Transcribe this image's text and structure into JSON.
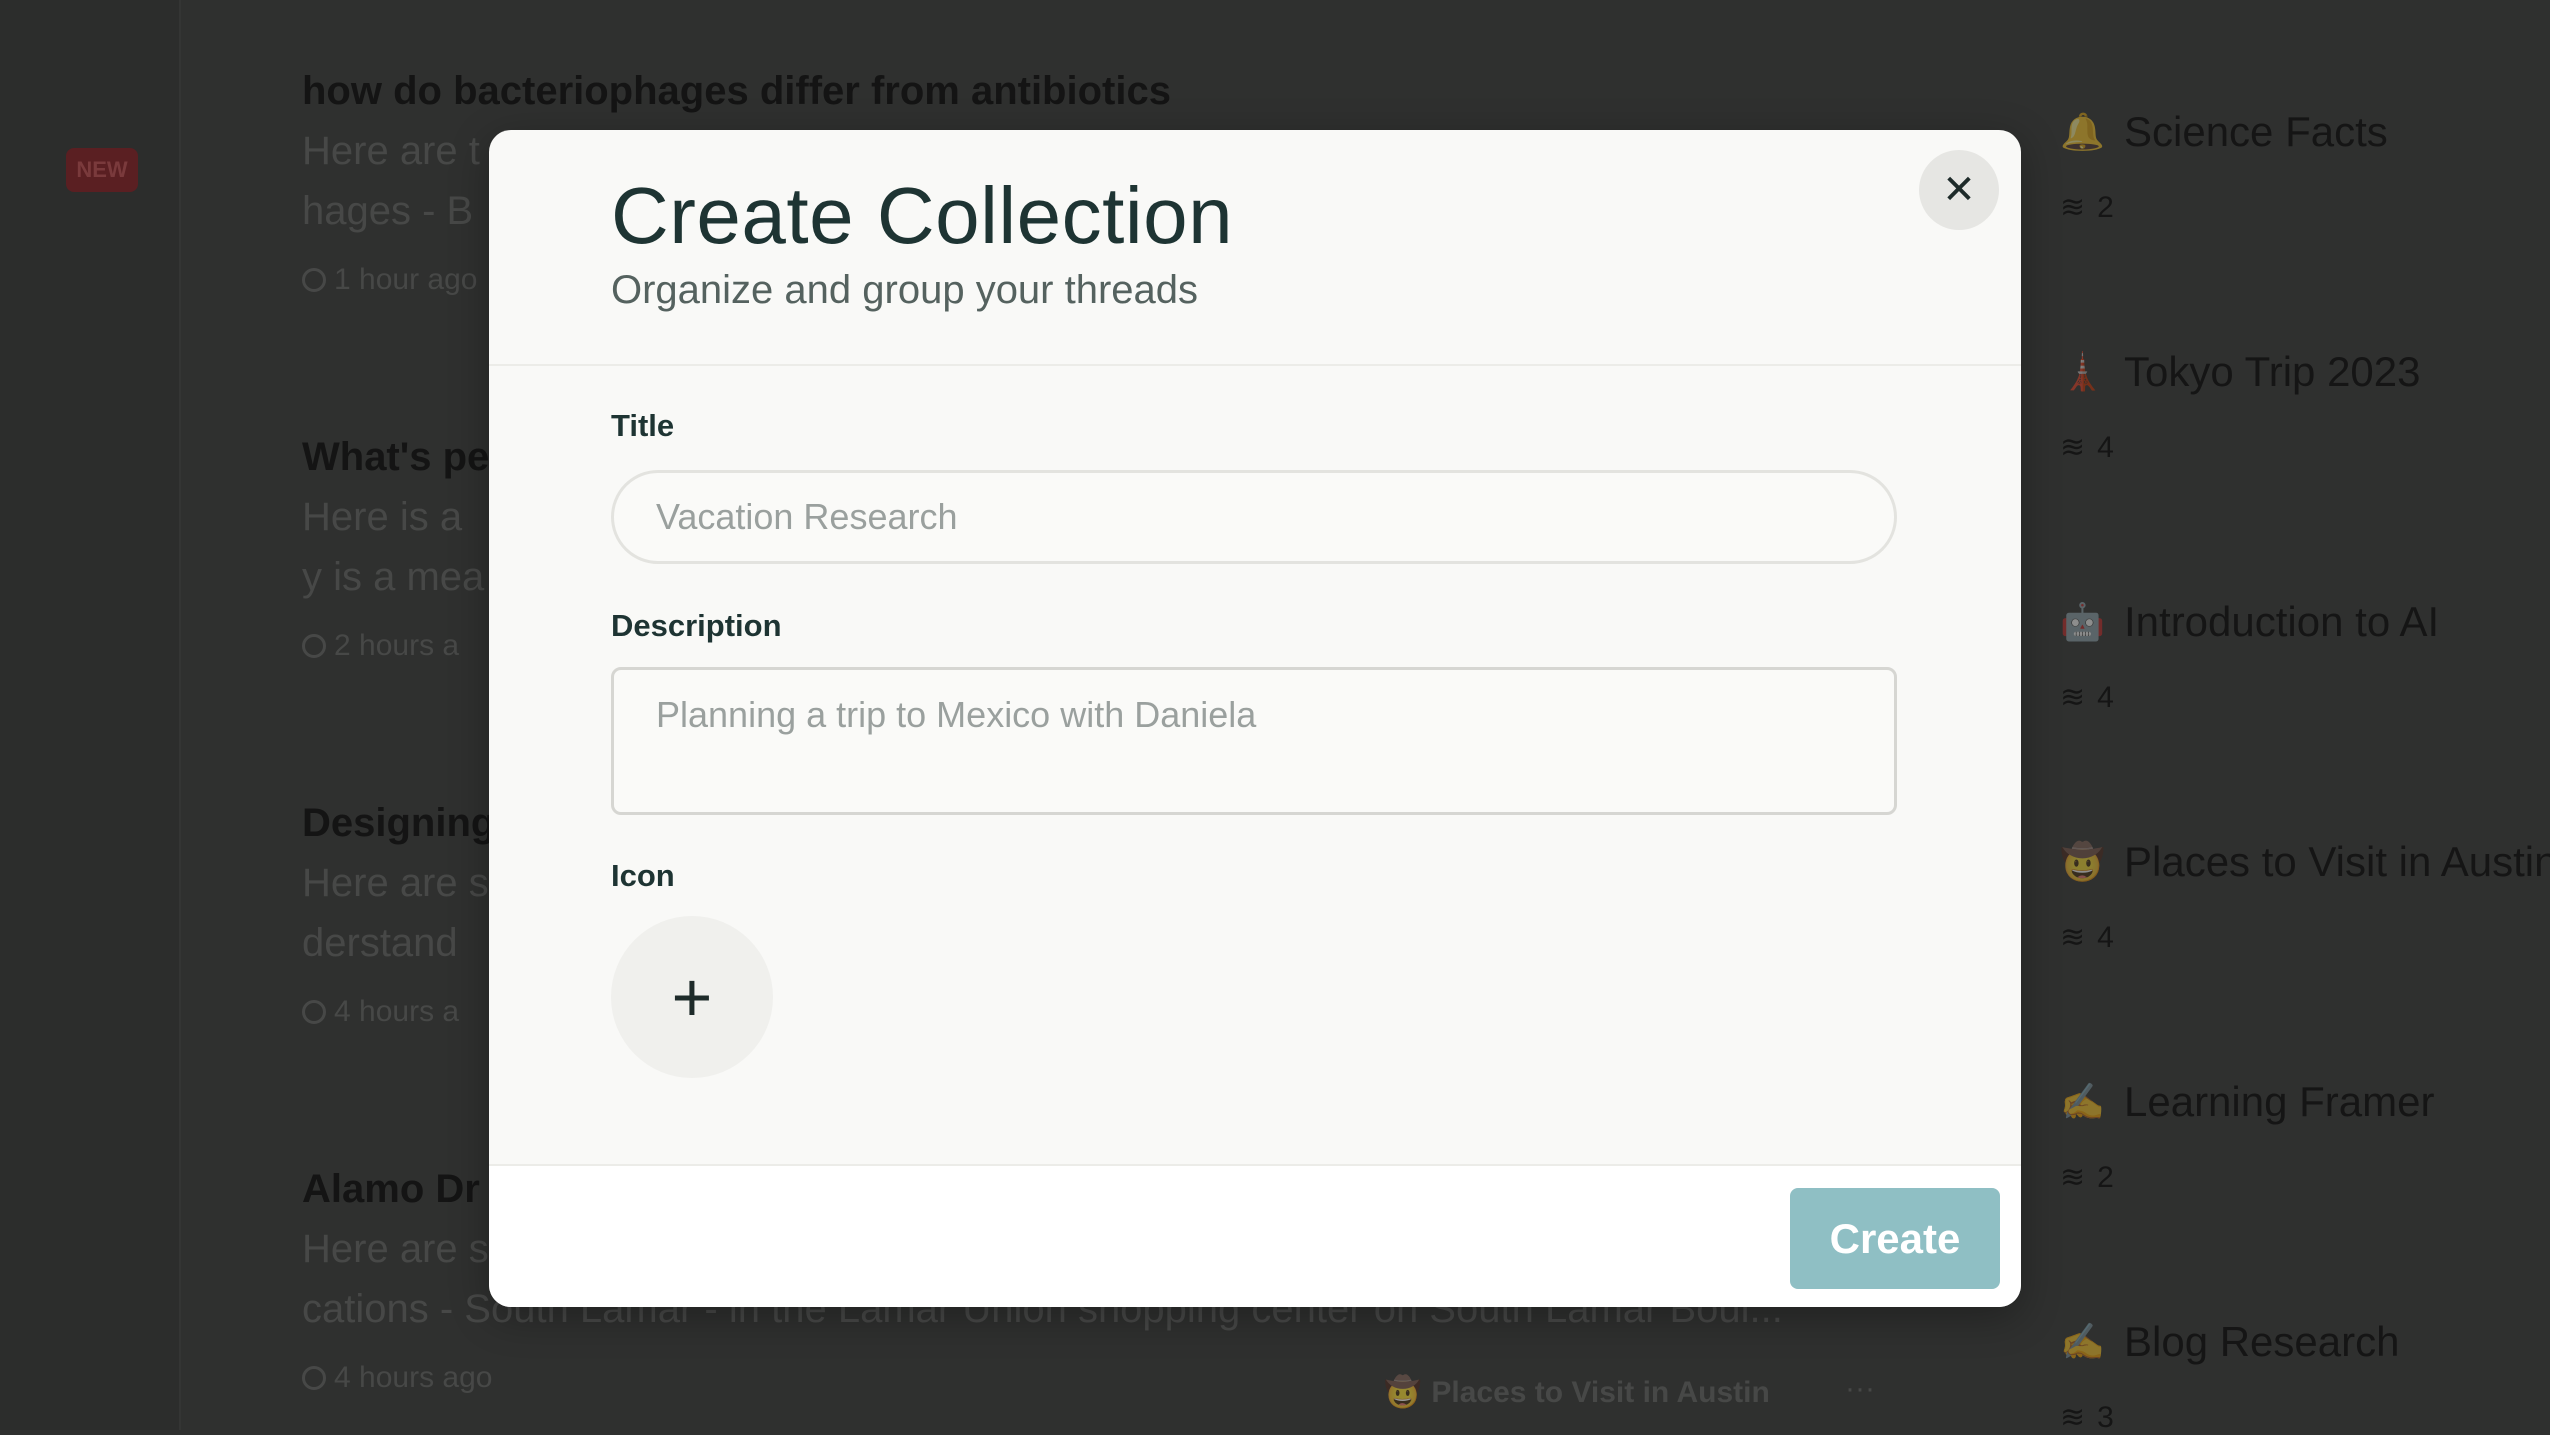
{
  "sidebar": {
    "badge": "NEW"
  },
  "threads": [
    {
      "title": "how do bacteriophages differ from antibiotics",
      "lines": [
        "Here are t",
        "hages - B"
      ],
      "time": "1 hour ago"
    },
    {
      "title": "What's pe",
      "lines": [
        "Here is a",
        "y is a mea"
      ],
      "time": "2 hours a"
    },
    {
      "title": "Designing",
      "lines": [
        "Here are s",
        "derstand"
      ],
      "time": "4 hours a"
    },
    {
      "title": "Alamo Dr",
      "lines": [
        "Here are s",
        "cations - South Lamar - in the Lamar Union shopping center on South Lamar Boul..."
      ],
      "time": "4 hours ago",
      "collection": "Places to Visit in Austin",
      "more": "···"
    }
  ],
  "collections": [
    {
      "icon": "🔔",
      "name": "Science Facts",
      "count": "2"
    },
    {
      "icon": "🗼",
      "name": "Tokyo Trip 2023",
      "count": "4"
    },
    {
      "icon": "🤖",
      "name": "Introduction to AI",
      "count": "4"
    },
    {
      "icon": "🤠",
      "name": "Places to Visit in Austin",
      "count": "4"
    },
    {
      "icon": "✍",
      "name": "Learning Framer",
      "count": "2"
    },
    {
      "icon": "✍",
      "name": "Blog Research",
      "count": "3"
    }
  ],
  "modal": {
    "title": "Create Collection",
    "subtitle": "Organize and group your threads",
    "close": "✕",
    "title_label": "Title",
    "title_placeholder": "Vacation Research",
    "description_label": "Description",
    "description_placeholder": "Planning a trip to Mexico with Daniela",
    "icon_label": "Icon",
    "icon_add": "+",
    "create_label": "Create",
    "accent": "#8fbfc4"
  }
}
